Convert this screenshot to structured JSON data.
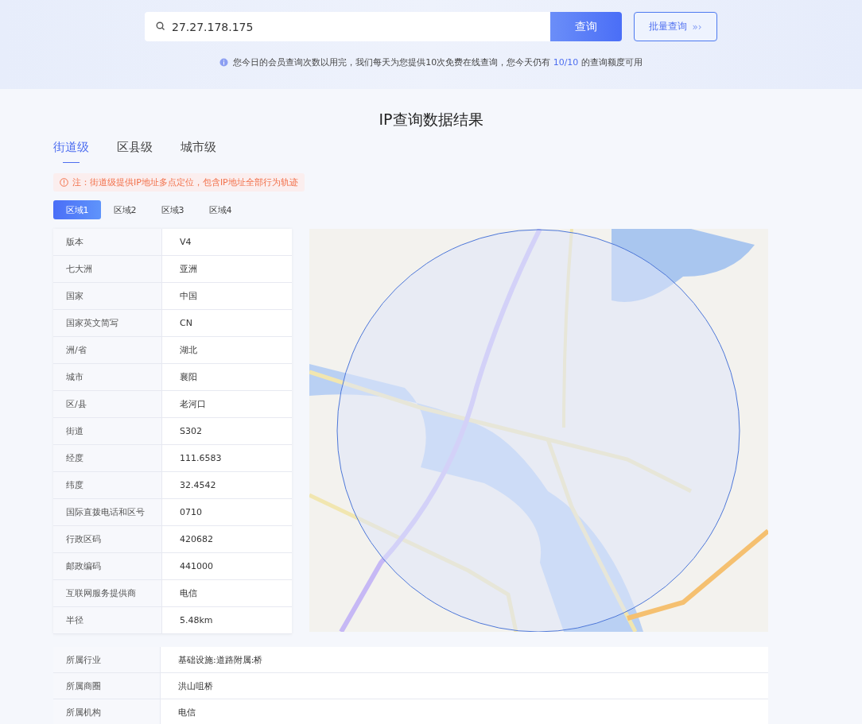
{
  "search": {
    "value": "27.27.178.175",
    "button": "查询",
    "batch_button": "批量查询",
    "batch_arrows": "»›"
  },
  "notice": {
    "before": "您今日的会员查询次数以用完，我们每天为您提供10次免费在线查询，您今天仍有",
    "quota": "10/10",
    "after": "的查询额度可用"
  },
  "title": "IP查询数据结果",
  "level_tabs": [
    {
      "label": "街道级",
      "selected": true
    },
    {
      "label": "区县级",
      "selected": false
    },
    {
      "label": "城市级",
      "selected": false
    }
  ],
  "note": "注：街道级提供IP地址多点定位，包含IP地址全部行为轨迹",
  "region_tabs": [
    {
      "label": "区域1",
      "selected": true
    },
    {
      "label": "区域2",
      "selected": false
    },
    {
      "label": "区域3",
      "selected": false
    },
    {
      "label": "区域4",
      "selected": false
    }
  ],
  "details": [
    {
      "label": "版本",
      "value": "V4"
    },
    {
      "label": "七大洲",
      "value": "亚洲"
    },
    {
      "label": "国家",
      "value": "中国"
    },
    {
      "label": "国家英文简写",
      "value": "CN"
    },
    {
      "label": "洲/省",
      "value": "湖北"
    },
    {
      "label": "城市",
      "value": "襄阳"
    },
    {
      "label": "区/县",
      "value": "老河口"
    },
    {
      "label": "街道",
      "value": "S302"
    },
    {
      "label": "经度",
      "value": "111.6583"
    },
    {
      "label": "纬度",
      "value": "32.4542"
    },
    {
      "label": "国际直拨电话和区号",
      "value": "0710"
    },
    {
      "label": "行政区码",
      "value": "420682"
    },
    {
      "label": "邮政编码",
      "value": "441000"
    },
    {
      "label": "互联网服务提供商",
      "value": "电信"
    },
    {
      "label": "半径",
      "value": "5.48km"
    }
  ],
  "extra": [
    {
      "label": "所属行业",
      "value": "基础设施:道路附属:桥"
    },
    {
      "label": "所属商圈",
      "value": "洪山咀桥"
    },
    {
      "label": "所属机构",
      "value": "电信"
    }
  ]
}
